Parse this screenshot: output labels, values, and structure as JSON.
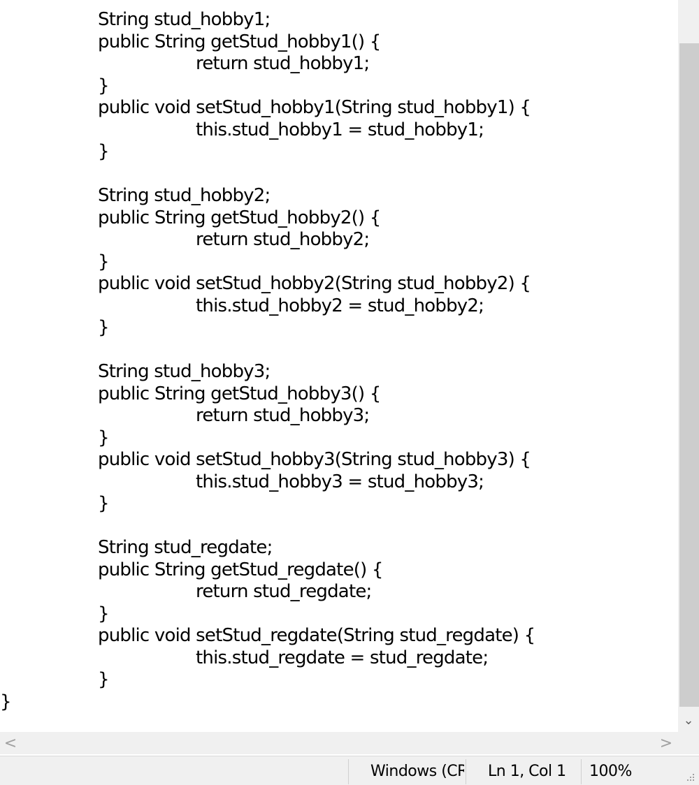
{
  "editor": {
    "lines": [
      "\t\tString stud_hobby1;",
      "\t\tpublic String getStud_hobby1() {",
      "\t\t\t\treturn stud_hobby1;",
      "\t\t}",
      "\t\tpublic void setStud_hobby1(String stud_hobby1) {",
      "\t\t\t\tthis.stud_hobby1 = stud_hobby1;",
      "\t\t}",
      "",
      "\t\tString stud_hobby2;",
      "\t\tpublic String getStud_hobby2() {",
      "\t\t\t\treturn stud_hobby2;",
      "\t\t}",
      "\t\tpublic void setStud_hobby2(String stud_hobby2) {",
      "\t\t\t\tthis.stud_hobby2 = stud_hobby2;",
      "\t\t}",
      "",
      "\t\tString stud_hobby3;",
      "\t\tpublic String getStud_hobby3() {",
      "\t\t\t\treturn stud_hobby3;",
      "\t\t}",
      "\t\tpublic void setStud_hobby3(String stud_hobby3) {",
      "\t\t\t\tthis.stud_hobby3 = stud_hobby3;",
      "\t\t}",
      "",
      "\t\tString stud_regdate;",
      "\t\tpublic String getStud_regdate() {",
      "\t\t\t\treturn stud_regdate;",
      "\t\t}",
      "\t\tpublic void setStud_regdate(String stud_regdate) {",
      "\t\t\t\tthis.stud_regdate = stud_regdate;",
      "\t\t}",
      "}"
    ]
  },
  "scrollbars": {
    "down_arrow": "⌄",
    "left_arrow": "<",
    "right_arrow": ">"
  },
  "statusbar": {
    "encoding": "Windows (CRLF)",
    "position": "Ln 1, Col 1",
    "zoom": "100%"
  },
  "colors": {
    "background": "#ffffff",
    "chrome": "#f0f0f0",
    "scroll_thumb": "#cdcdcd",
    "text": "#000000"
  },
  "icons": {
    "size_grip": "size-grip-icon"
  }
}
